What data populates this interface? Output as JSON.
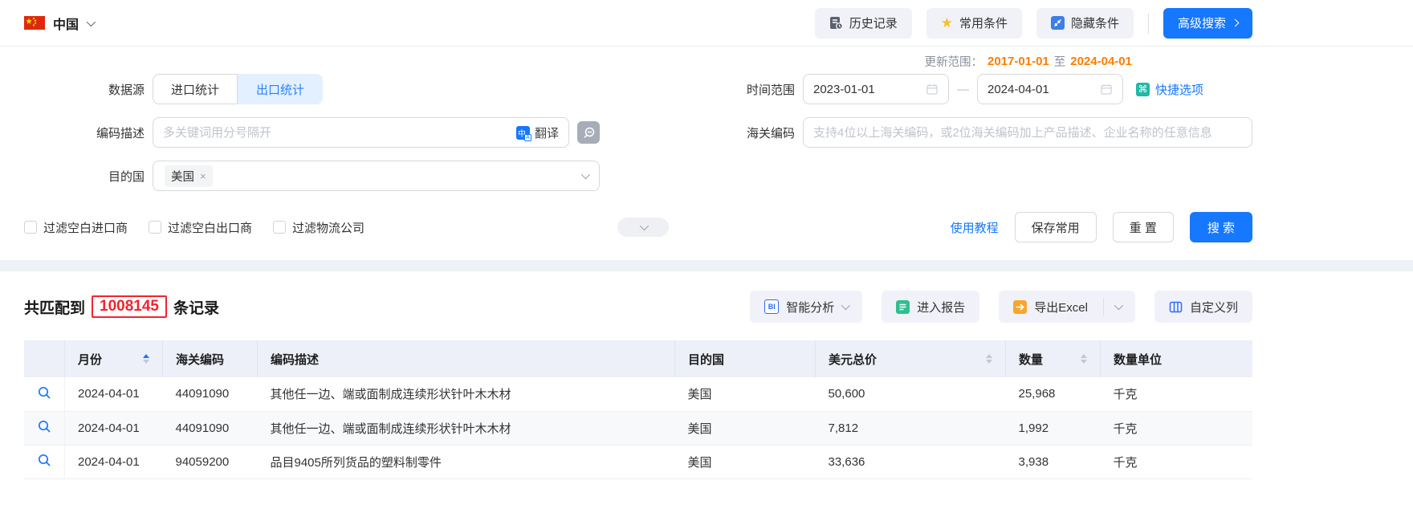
{
  "colors": {
    "accent": "#1677ff",
    "update_orange": "#ff7d00",
    "count_red": "#f5222d",
    "active_tab_bg": "#e3f0ff"
  },
  "topbar": {
    "country": "中国",
    "history_label": "历史记录",
    "favorites_label": "常用条件",
    "favorites_star_glyph": "★",
    "hide_label": "隐藏条件",
    "advanced_label": "高级搜索"
  },
  "filters": {
    "update_range": {
      "label": "更新范围：",
      "start": "2017-01-01",
      "to": "至",
      "end": "2024-04-01"
    },
    "datasource": {
      "label": "数据源",
      "import_tab": "进口统计",
      "export_tab": "出口统计"
    },
    "time_range": {
      "label": "时间范围",
      "start": "2023-01-01",
      "dash": "—",
      "end": "2024-04-01",
      "quick": "快捷选项",
      "quick_glyph": "⌘"
    },
    "code_desc": {
      "label": "编码描述",
      "placeholder": "多关键词用分号隔开",
      "translate": "翻译",
      "translate_glyph_main": "中",
      "translate_glyph_sub": "A"
    },
    "hs_code": {
      "label": "海关编码",
      "placeholder": "支持4位以上海关编码，或2位海关编码加上产品描述、企业名称的任意信息"
    },
    "destination": {
      "label": "目的国",
      "tag": "美国",
      "tag_close_glyph": "×"
    },
    "checkboxes": [
      "过滤空白进口商",
      "过滤空白出口商",
      "过滤物流公司"
    ],
    "actions": {
      "tutorial": "使用教程",
      "save": "保存常用",
      "reset": "重 置",
      "search": "搜 索"
    }
  },
  "results": {
    "summary": {
      "prefix": "共匹配到",
      "count": "1008145",
      "suffix": "条记录"
    },
    "toolbar": {
      "analysis": "智能分析",
      "analysis_icon_text": "BI",
      "report": "进入报告",
      "export": "导出Excel",
      "columns": "自定义列"
    },
    "table": {
      "headers": [
        "月份",
        "海关编码",
        "编码描述",
        "目的国",
        "美元总价",
        "数量",
        "数量单位"
      ],
      "rows": [
        {
          "month": "2024-04-01",
          "hs": "44091090",
          "desc": "其他任一边、端或面制成连续形状针叶木木材",
          "country": "美国",
          "usd": "50,600",
          "qty": "25,968",
          "unit": "千克"
        },
        {
          "month": "2024-04-01",
          "hs": "44091090",
          "desc": "其他任一边、端或面制成连续形状针叶木木材",
          "country": "美国",
          "usd": "7,812",
          "qty": "1,992",
          "unit": "千克"
        },
        {
          "month": "2024-04-01",
          "hs": "94059200",
          "desc": "品目9405所列货品的塑料制零件",
          "country": "美国",
          "usd": "33,636",
          "qty": "3,938",
          "unit": "千克"
        }
      ]
    }
  }
}
